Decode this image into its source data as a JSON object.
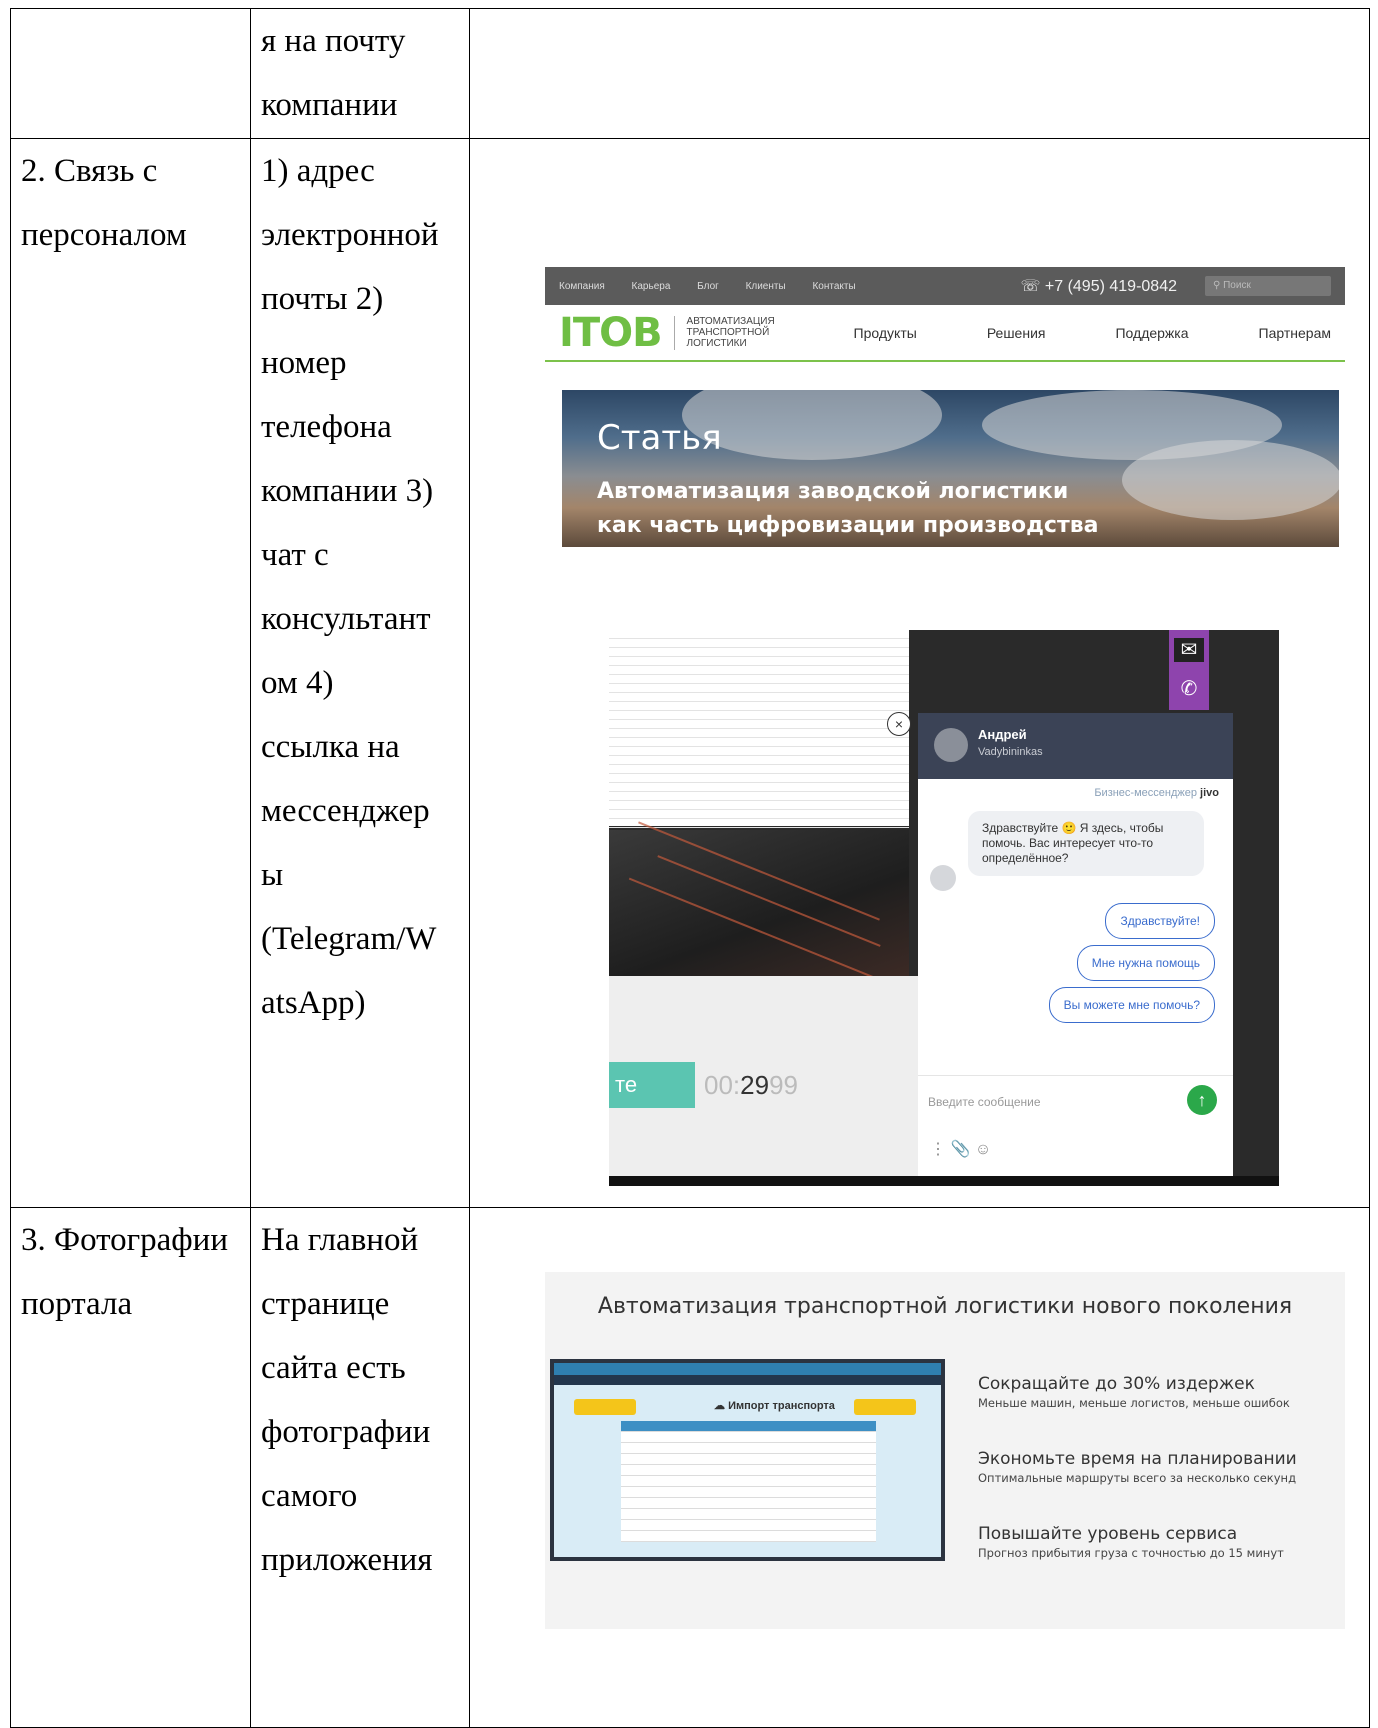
{
  "table": {
    "row0": {
      "col2": [
        "я на почту",
        "компании"
      ]
    },
    "row1": {
      "col1": [
        "2. Связь с",
        "персоналом"
      ],
      "col2": [
        "1) адрес",
        "электронной",
        "почты 2)",
        "номер",
        "телефона",
        "компании 3)",
        "чат с",
        "консультант",
        "ом 4)",
        "ссылка на",
        "мессенджер",
        "ы",
        "(Telegram/W",
        "atsApp)"
      ]
    },
    "row2": {
      "col1": [
        "3. Фотографии",
        "портала"
      ],
      "col2": [
        "На главной",
        "странице",
        "сайта есть",
        "фотографии",
        "самого",
        "приложения"
      ]
    }
  },
  "shot1": {
    "nav": [
      "Компания",
      "Карьера",
      "Блог",
      "Клиенты",
      "Контакты"
    ],
    "phone": "+7 (495) 419-0842",
    "search_placeholder": "Поиск",
    "logo": "ITOB",
    "logo_sub": "АВТОМАТИЗАЦИЯ ТРАНСПОРТНОЙ ЛОГИСТИКИ",
    "menu": [
      "Продукты",
      "Решения",
      "Поддержка",
      "Партнерам"
    ],
    "banner_title": "Статья",
    "banner_sub1": "Автоматизация заводской логистики",
    "banner_sub2": "как часть цифровизации производства"
  },
  "shot2": {
    "agent_name": "Андрей",
    "agent_handle": "Vadybininkas",
    "brand": "Бизнес-мессенджер",
    "brand_logo": "jivo",
    "greeting": "Здравствуйте 🙂 Я здесь, чтобы помочь. Вас интересует что-то определённое?",
    "chips": [
      "Здравствуйте!",
      "Мне нужна помощь",
      "Вы можете мне помочь?"
    ],
    "input_placeholder": "Введите сообщение",
    "button_partial": "те",
    "timer_pre": "00:",
    "timer_main": "29",
    "timer_post": "99"
  },
  "shot3": {
    "title": "Автоматизация транспортной логистики нового поколения",
    "screen_title": "Импорт транспорта",
    "features": [
      {
        "title": "Сокращайте до 30% издержек",
        "desc": "Меньше машин, меньше логистов, меньше ошибок"
      },
      {
        "title": "Экономьте время на планировании",
        "desc": "Оптимальные маршруты всего за несколько секунд"
      },
      {
        "title": "Повышайте уровень сервиса",
        "desc": "Прогноз прибытия груза с точностью до 15 минут"
      }
    ]
  },
  "colors": {
    "itob_green": "#6fbe44",
    "chat_header": "#3b4356",
    "send_green": "#2ba84a",
    "chip_blue": "#3a6ccd"
  }
}
